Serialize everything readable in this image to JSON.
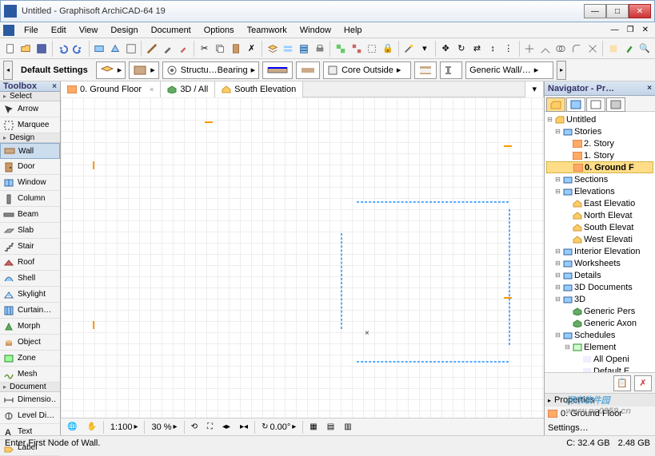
{
  "window": {
    "title": "Untitled - Graphisoft ArchiCAD-64 19"
  },
  "menu": [
    "File",
    "Edit",
    "View",
    "Design",
    "Document",
    "Options",
    "Teamwork",
    "Window",
    "Help"
  ],
  "infobox": {
    "label": "Default Settings",
    "structural": "Structu…Bearing",
    "core": "Core Outside",
    "wall_comp": "Generic Wall/…"
  },
  "toolbox": {
    "title": "Toolbox",
    "sections": {
      "select": "Select",
      "design": "Design",
      "document": "Document"
    },
    "select_tools": [
      {
        "name": "Arrow",
        "icon": "arrow"
      },
      {
        "name": "Marquee",
        "icon": "marquee"
      }
    ],
    "design_tools": [
      {
        "name": "Wall",
        "icon": "wall",
        "selected": true
      },
      {
        "name": "Door",
        "icon": "door"
      },
      {
        "name": "Window",
        "icon": "window"
      },
      {
        "name": "Column",
        "icon": "column"
      },
      {
        "name": "Beam",
        "icon": "beam"
      },
      {
        "name": "Slab",
        "icon": "slab"
      },
      {
        "name": "Stair",
        "icon": "stair"
      },
      {
        "name": "Roof",
        "icon": "roof"
      },
      {
        "name": "Shell",
        "icon": "shell"
      },
      {
        "name": "Skylight",
        "icon": "skylight"
      },
      {
        "name": "Curtain…",
        "icon": "curtain"
      },
      {
        "name": "Morph",
        "icon": "morph"
      },
      {
        "name": "Object",
        "icon": "object"
      },
      {
        "name": "Zone",
        "icon": "zone"
      },
      {
        "name": "Mesh",
        "icon": "mesh"
      }
    ],
    "document_tools": [
      {
        "name": "Dimensio…",
        "icon": "dimension"
      },
      {
        "name": "Level Di…",
        "icon": "level"
      },
      {
        "name": "Text",
        "icon": "text"
      },
      {
        "name": "Label",
        "icon": "label"
      }
    ]
  },
  "tabs": [
    {
      "label": "0. Ground Floor",
      "icon": "plan",
      "closable": true
    },
    {
      "label": "3D / All",
      "icon": "3d",
      "closable": false
    },
    {
      "label": "South Elevation",
      "icon": "elevation",
      "closable": false
    }
  ],
  "quickbar": {
    "scale": "1:100",
    "zoom": "30 %",
    "angle": "0.00°"
  },
  "navigator": {
    "title": "Navigator - Pr…",
    "root": "Untitled",
    "stories_label": "Stories",
    "stories": [
      "2. Story",
      "1. Story",
      "0. Ground F"
    ],
    "sections": "Sections",
    "elevations_label": "Elevations",
    "elevations": [
      "East Elevatio",
      "North Elevat",
      "South Elevat",
      "West Elevati"
    ],
    "interior": "Interior Elevation",
    "worksheets": "Worksheets",
    "details": "Details",
    "docs3d": "3D Documents",
    "d3": "3D",
    "d3_items": [
      "Generic Pers",
      "Generic Axon"
    ],
    "schedules": "Schedules",
    "element": "Element",
    "element_items": [
      "All Openi",
      "Default E"
    ]
  },
  "properties": {
    "title": "Properties",
    "row1": "0. Ground Floor",
    "row2": "Settings…"
  },
  "status": {
    "message": "Enter First Node of Wall.",
    "c_drive": "C: 32.4 GB",
    "mem": "2.48 GB"
  },
  "watermark": {
    "text": "河东软件园",
    "url": "www.pc0359.cn"
  }
}
